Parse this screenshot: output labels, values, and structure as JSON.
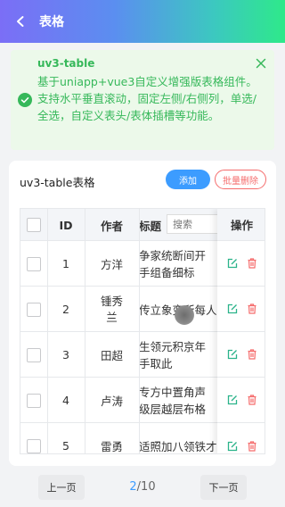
{
  "navbar": {
    "title": "表格"
  },
  "notice": {
    "title": "uv3-table",
    "text": "基于uniapp+vue3自定义增强版表格组件。支持水平垂直滚动，固定左侧/右侧列，单选/全选，自定义表头/表体插槽等功能。"
  },
  "card": {
    "title": "uv3-table表格",
    "add_label": "添加",
    "batch_delete_label": "批量删除"
  },
  "table": {
    "headers": {
      "id": "ID",
      "author": "作者",
      "title": "标题",
      "search_placeholder": "搜索",
      "actions": "操作"
    },
    "rows": [
      {
        "id": "1",
        "author": "方洋",
        "title": "争家统断间开手组备细标"
      },
      {
        "id": "2",
        "author": "锺秀兰",
        "title": "传立象变所每人"
      },
      {
        "id": "3",
        "author": "田超",
        "title": "生领元积京年手取此"
      },
      {
        "id": "4",
        "author": "卢涛",
        "title": "专方中置角声级层越层布格周"
      },
      {
        "id": "5",
        "author": "雷勇",
        "title": "适照加八领铁才"
      }
    ]
  },
  "pagination": {
    "prev_label": "上一页",
    "current": "2",
    "total": "/10",
    "next_label": "下一页"
  },
  "colors": {
    "primary": "#3c9cff",
    "success": "#36b85a",
    "danger": "#f56c6c",
    "edit": "#2bb38a"
  }
}
